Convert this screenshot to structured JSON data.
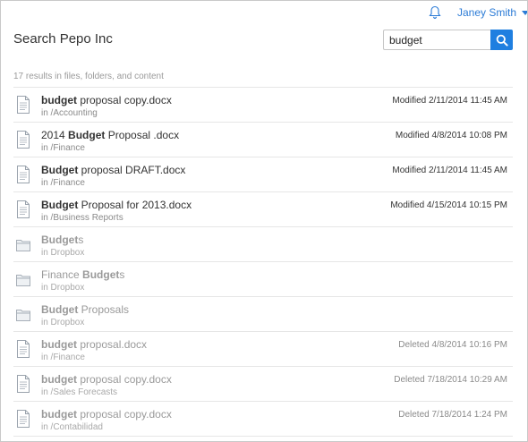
{
  "header": {
    "user_name": "Janey Smith"
  },
  "page": {
    "title": "Search Pepo Inc"
  },
  "search": {
    "value": "budget",
    "results_summary": "17 results in files, folders, and content"
  },
  "results": [
    {
      "type": "file",
      "pre": "",
      "bold": "budget",
      "post": " proposal copy.docx",
      "location": "in /Accounting",
      "meta": "Modified 2/11/2014 11:45 AM",
      "dim": false
    },
    {
      "type": "file",
      "pre": "2014 ",
      "bold": "Budget",
      "post": " Proposal .docx",
      "location": "in /Finance",
      "meta": "Modified 4/8/2014 10:08 PM",
      "dim": false
    },
    {
      "type": "file",
      "pre": "",
      "bold": "Budget",
      "post": " proposal DRAFT.docx",
      "location": "in /Finance",
      "meta": "Modified 2/11/2014 11:45 AM",
      "dim": false
    },
    {
      "type": "file",
      "pre": "",
      "bold": "Budget",
      "post": " Proposal for 2013.docx",
      "location": "in /Business Reports",
      "meta": "Modified 4/15/2014 10:15 PM",
      "dim": false
    },
    {
      "type": "folder",
      "pre": "",
      "bold": "Budget",
      "post": "s",
      "location": "in Dropbox",
      "meta": "",
      "dim": true
    },
    {
      "type": "folder",
      "pre": "Finance ",
      "bold": "Budget",
      "post": "s",
      "location": "in Dropbox",
      "meta": "",
      "dim": true
    },
    {
      "type": "folder",
      "pre": "",
      "bold": "Budget",
      "post": " Proposals",
      "location": "in Dropbox",
      "meta": "",
      "dim": true
    },
    {
      "type": "file",
      "pre": "",
      "bold": "budget",
      "post": " proposal.docx",
      "location": "in /Finance",
      "meta": "Deleted 4/8/2014 10:16 PM",
      "dim": true
    },
    {
      "type": "file",
      "pre": "",
      "bold": "budget",
      "post": " proposal copy.docx",
      "location": "in /Sales Forecasts",
      "meta": "Deleted 7/18/2014 10:29 AM",
      "dim": true
    },
    {
      "type": "file",
      "pre": "",
      "bold": "budget",
      "post": " proposal copy.docx",
      "location": "in /Contabilidad",
      "meta": "Deleted 7/18/2014 1:24 PM",
      "dim": true
    }
  ],
  "icons": {
    "notifications": "bell-icon",
    "search": "search-icon",
    "file": "document-icon",
    "folder": "folder-icon",
    "user_menu": "chevron-down-icon"
  },
  "colors": {
    "accent": "#1f7fe0",
    "link": "#2b7bd6",
    "muted_text": "#9a9a9a"
  }
}
